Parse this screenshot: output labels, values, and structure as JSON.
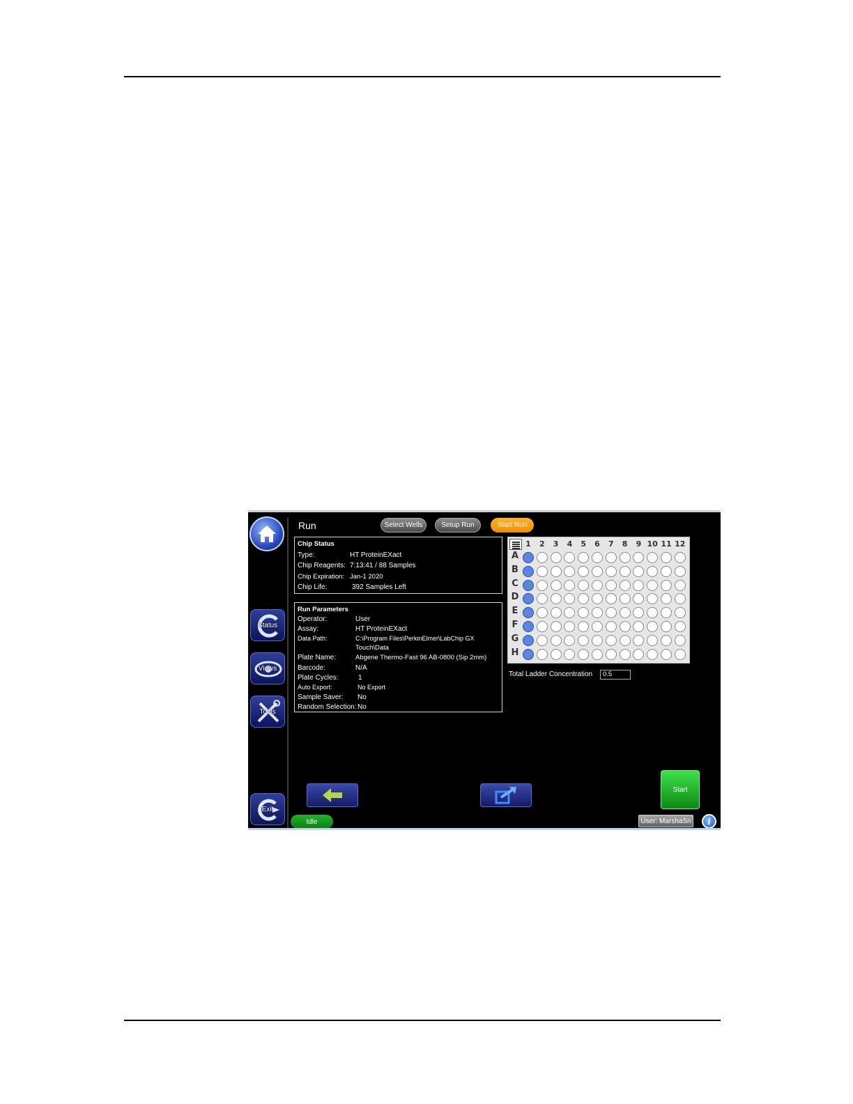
{
  "app": {
    "title": "Run",
    "tabs": [
      {
        "label": "Select Wells"
      },
      {
        "label": "Setup Run"
      },
      {
        "label": "Start Run"
      }
    ],
    "sidebar": {
      "status_label": "Status",
      "views_label": "Views",
      "tools_label": "Tools",
      "exit_label": "Exit"
    },
    "chip_status": {
      "title": "Chip Status",
      "rows": [
        {
          "label": "Type:",
          "value": "HT ProteinEXact"
        },
        {
          "label": "Chip Reagents:",
          "value": "7:13:41 / 88 Samples"
        },
        {
          "label": "Chip Expiration:",
          "value": "Jan-1 2020"
        },
        {
          "label": "Chip Life:",
          "value": "392 Samples Left"
        }
      ]
    },
    "run_parameters": {
      "title": "Run Parameters",
      "operator_label": "Operator:",
      "operator": "User",
      "assay_label": "Assay:",
      "assay": "HT ProteinEXact",
      "data_path_label": "Data Path:",
      "data_path_1": "C:\\Program Files\\PerkinElmer\\LabChip GX",
      "data_path_2": "Touch\\Data",
      "plate_name_label": "Plate Name:",
      "plate_name": "Abgene Thermo-Fast 96 AB-0800 (Sip 2mm)",
      "barcode_label": "Barcode:",
      "barcode": "N/A",
      "plate_cycles_label": "Plate Cycles:",
      "plate_cycles": "1",
      "auto_export_label": "Auto Export:",
      "auto_export": "No Export",
      "sample_saver_label": "Sample Saver:",
      "sample_saver": "No",
      "random_selection_label": "Random Selection:",
      "random_selection": "No"
    },
    "plate": {
      "columns": [
        "1",
        "2",
        "3",
        "4",
        "5",
        "6",
        "7",
        "8",
        "9",
        "10",
        "11",
        "12"
      ],
      "rows": [
        "A",
        "B",
        "C",
        "D",
        "E",
        "F",
        "G",
        "H"
      ],
      "selected_columns": [
        1
      ]
    },
    "ladder": {
      "label": "Total Ladder Concentration",
      "value": "0.5"
    },
    "start_label": "Start",
    "status": "Idle",
    "user": "User: MarshaSn",
    "info_glyph": "i",
    "colors": {
      "accent": "#f39a0c",
      "start": "#1fb82b",
      "selected_well": "#5a86e0"
    }
  }
}
